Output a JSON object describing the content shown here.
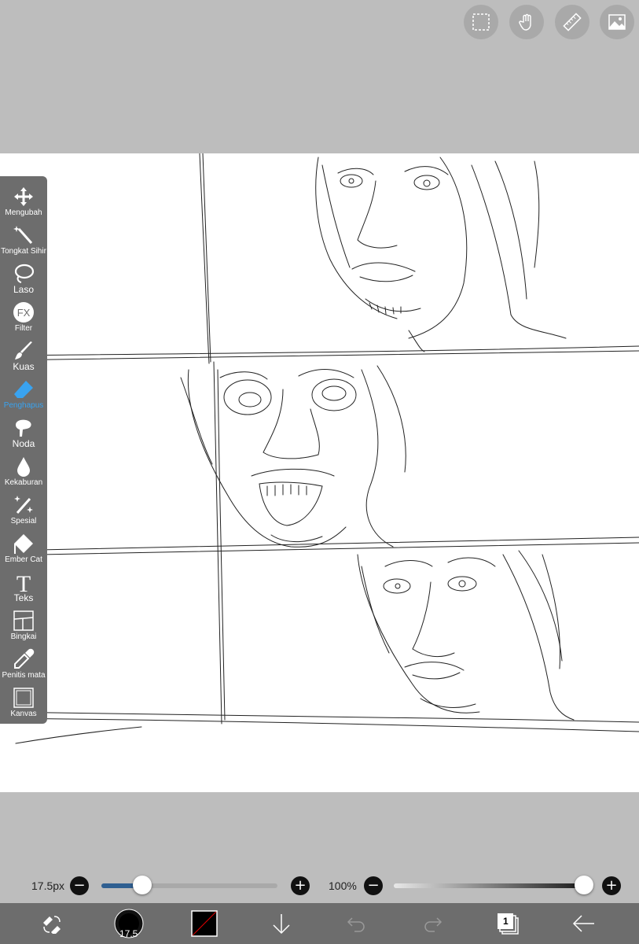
{
  "top_buttons": [
    {
      "icon": "selection-icon"
    },
    {
      "icon": "hand-icon"
    },
    {
      "icon": "ruler-icon"
    },
    {
      "icon": "image-icon"
    }
  ],
  "tools": [
    {
      "label": "Mengubah",
      "icon": "move-icon"
    },
    {
      "label": "Tongkat Sihir",
      "icon": "magic-wand-icon"
    },
    {
      "label": "Laso",
      "icon": "lasso-icon"
    },
    {
      "label": "Filter",
      "icon": "fx-icon",
      "glyph": "FX"
    },
    {
      "label": "Kuas",
      "icon": "brush-icon"
    },
    {
      "label": "Penghapus",
      "icon": "eraser-icon",
      "active": true
    },
    {
      "label": "Noda",
      "icon": "smudge-icon"
    },
    {
      "label": "Kekaburan",
      "icon": "blur-drop-icon"
    },
    {
      "label": "Spesial",
      "icon": "special-icon"
    },
    {
      "label": "Ember Cat",
      "icon": "paint-bucket-icon"
    },
    {
      "label": "Teks",
      "icon": "text-icon",
      "glyph": "T"
    },
    {
      "label": "Bingkai",
      "icon": "frame-icon"
    },
    {
      "label": "Penitis mata",
      "icon": "eyedropper-icon"
    },
    {
      "label": "Kanvas",
      "icon": "canvas-icon"
    }
  ],
  "brush_size": {
    "label": "17.5px",
    "value": 17.5,
    "fraction": 0.23
  },
  "opacity": {
    "label": "100%",
    "value": 100,
    "fraction": 1.0
  },
  "bottom_bar": {
    "brush_preview_value": "17.5",
    "layer_count": "1",
    "icons": [
      "tool-swap-icon",
      "brush-size-preview-icon",
      "color-swatch-icon",
      "download-icon",
      "undo-icon",
      "redo-icon",
      "layers-icon",
      "back-arrow-icon"
    ]
  },
  "colors": {
    "active": "#39a3f0",
    "toolbar": "#6d6d6d",
    "background": "#bdbdbd",
    "slider_fill": "#2f5f91"
  }
}
